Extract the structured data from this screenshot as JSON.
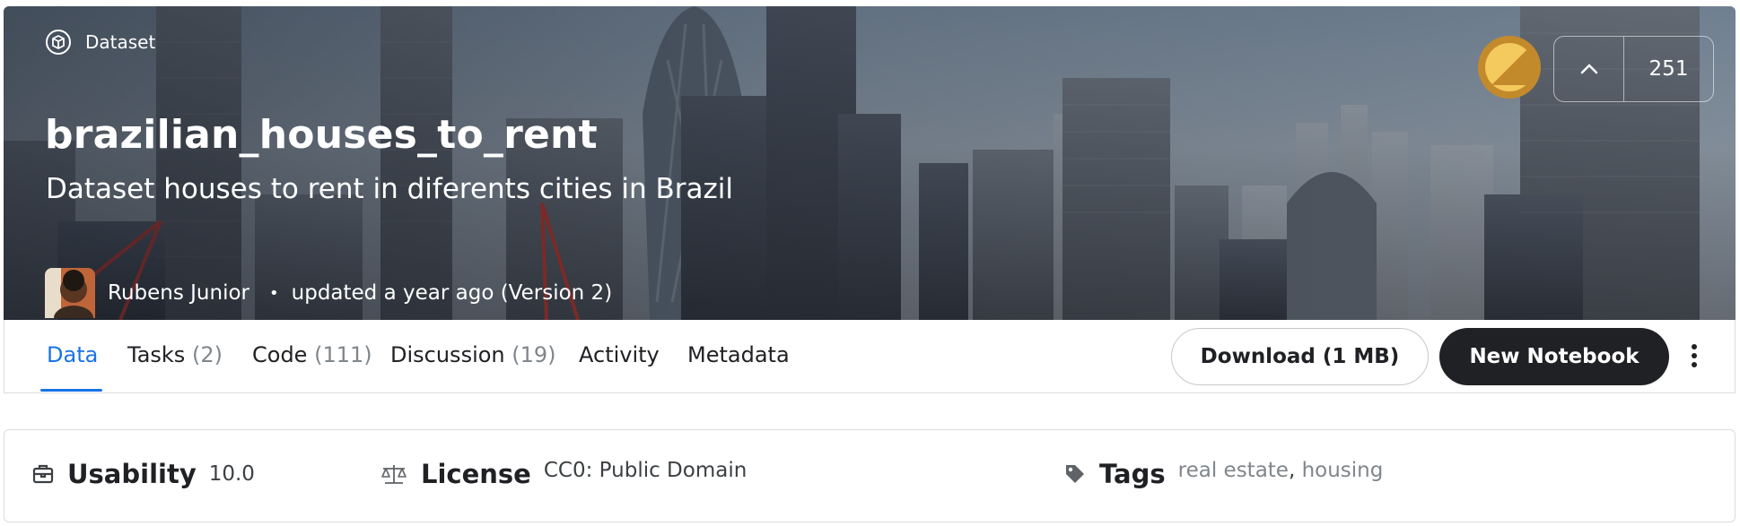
{
  "hero": {
    "chip_label": "Dataset",
    "title": "brazilian_houses_to_rent",
    "subtitle": "Dataset houses to rent in diferents cities in Brazil",
    "author": "Rubens Junior",
    "updated": "updated a year ago (Version 2)",
    "medal_color": "#c38a2c",
    "vote_count": "251"
  },
  "tabs": [
    {
      "label": "Data",
      "count": ""
    },
    {
      "label": "Tasks",
      "count": "(2)"
    },
    {
      "label": "Code",
      "count": "(111)"
    },
    {
      "label": "Discussion",
      "count": "(19)"
    },
    {
      "label": "Activity",
      "count": ""
    },
    {
      "label": "Metadata",
      "count": ""
    }
  ],
  "actions": {
    "download": "Download (1 MB)",
    "new_notebook": "New Notebook"
  },
  "info": {
    "usability_label": "Usability",
    "usability_value": "10.0",
    "license_label": "License",
    "license_value": "CC0: Public Domain",
    "tags_label": "Tags",
    "tags": [
      "real estate",
      "housing"
    ]
  },
  "colors": {
    "accent": "#1a73e8",
    "primary_button": "#202124"
  },
  "icons": {
    "chip": "dataset-icon",
    "upvote": "chevron-up-icon",
    "more": "kebab-icon",
    "usability": "toolbox-icon",
    "license": "scale-icon",
    "tags": "tag-icon"
  }
}
